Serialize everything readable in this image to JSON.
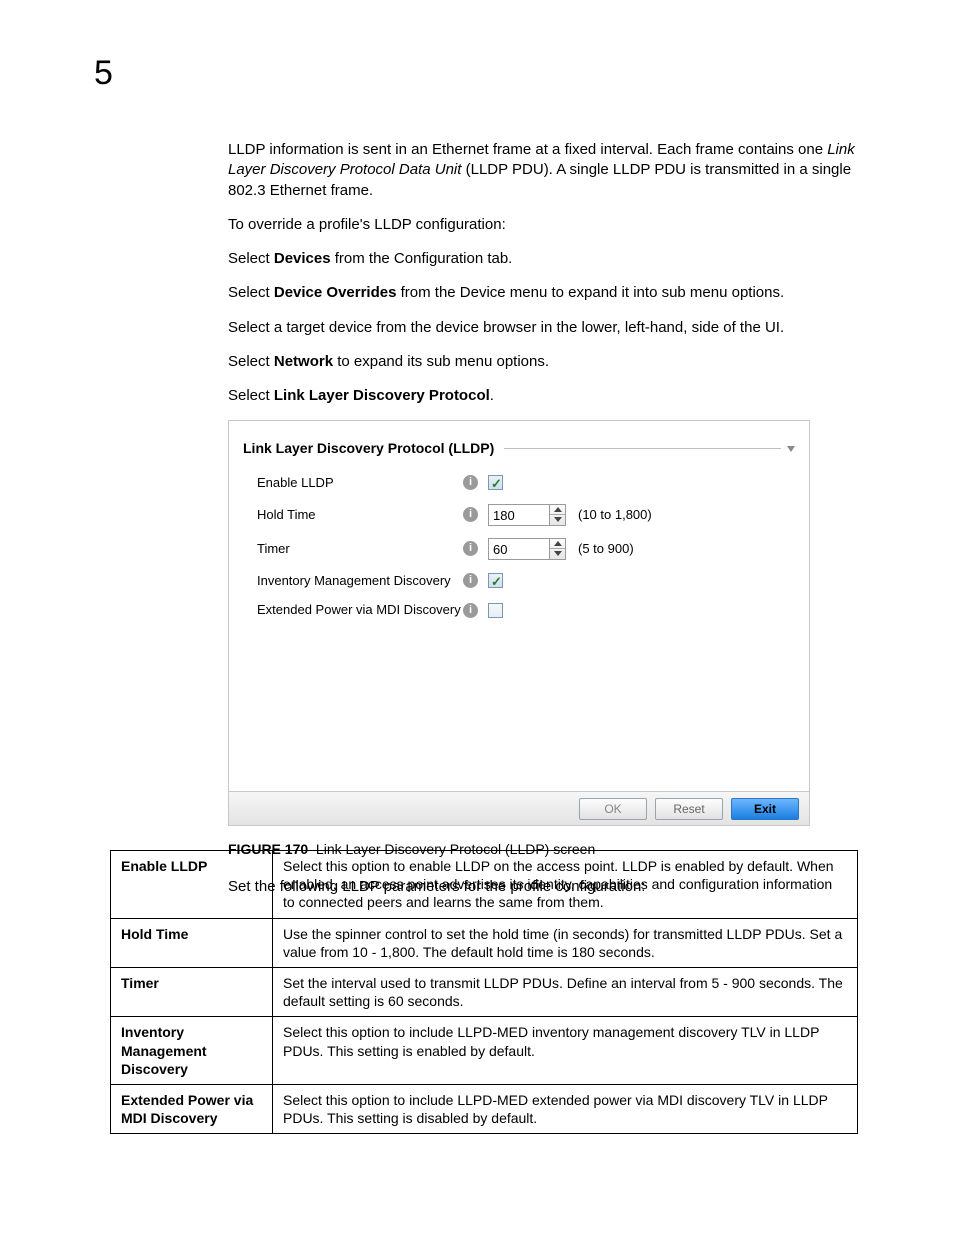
{
  "page_number": "5",
  "intro": {
    "p1a": "LLDP information is sent in an Ethernet frame at a fixed interval. Each frame contains one ",
    "p1b": "Link Layer Discovery Protocol Data Unit",
    "p1c": " (LLDP PDU). A single LLDP PDU is transmitted in a single 802.3 Ethernet frame.",
    "p2": "To override a profile's LLDP configuration:",
    "p3a": "Select ",
    "p3b": "Devices",
    "p3c": " from the Configuration tab.",
    "p4a": "Select ",
    "p4b": "Device Overrides",
    "p4c": " from the Device menu to expand it into sub menu options.",
    "p5": "Select a target device from the device browser in the lower, left-hand, side of the UI.",
    "p6a": "Select ",
    "p6b": "Network",
    "p6c": " to expand its sub menu options.",
    "p7a": "Select ",
    "p7b": "Link Layer Discovery Protocol",
    "p7c": "."
  },
  "panel": {
    "title": "Link Layer Discovery Protocol (LLDP)",
    "rows": {
      "enable": {
        "label": "Enable LLDP"
      },
      "hold": {
        "label": "Hold Time",
        "value": "180",
        "hint": "(10 to 1,800)"
      },
      "timer": {
        "label": "Timer",
        "value": "60",
        "hint": "(5 to 900)"
      },
      "inv": {
        "label": "Inventory Management Discovery"
      },
      "ext": {
        "label": "Extended Power via MDI Discovery"
      }
    },
    "buttons": {
      "ok": "OK",
      "reset": "Reset",
      "exit": "Exit"
    }
  },
  "caption": {
    "fig": "FIGURE 170",
    "text": "Link Layer Discovery Protocol (LLDP) screen"
  },
  "params_intro": "Set the following LLDP parameters for the profile configuration:",
  "table": {
    "r1k": "Enable LLDP",
    "r1v": "Select this option to enable LLDP on the access point. LLDP is enabled by default. When enabled, an access point advertises its identity, capabilities and configuration information to connected peers and learns the same from them.",
    "r2k": "Hold Time",
    "r2v": "Use the spinner control to set the hold time (in seconds) for transmitted LLDP PDUs. Set a value from 10 - 1,800. The default hold time is 180 seconds.",
    "r3k": "Timer",
    "r3v": "Set the interval used to transmit LLDP PDUs. Define an interval from 5 - 900 seconds. The default setting is 60 seconds.",
    "r4k": "Inventory Management Discovery",
    "r4v": "Select this option to include LLPD-MED inventory management discovery TLV in LLDP PDUs. This setting is enabled by default.",
    "r5k": "Extended Power via MDI Discovery",
    "r5v": "Select this option to include LLPD-MED extended power via MDI discovery TLV in LLDP PDUs. This setting is disabled by default."
  }
}
